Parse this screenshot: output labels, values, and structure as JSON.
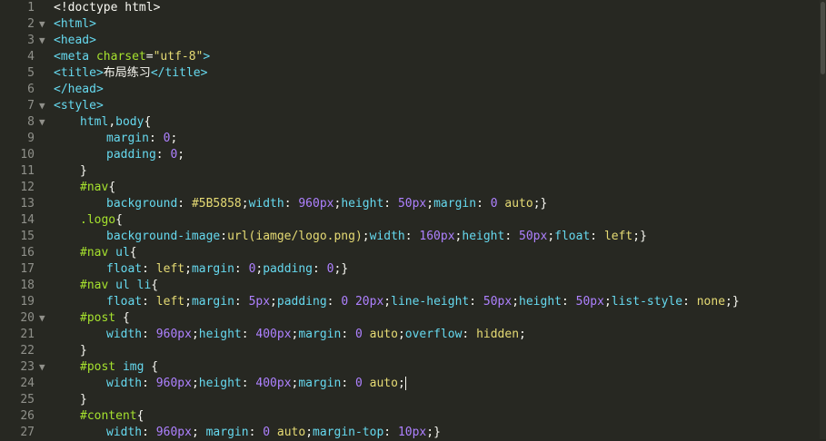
{
  "editor": {
    "colors": {
      "background": "#272822",
      "line_number": "#8f908a",
      "default": "#f8f8f2",
      "tag": "#66d9ef",
      "keyword": "#f92672",
      "attribute": "#a6e22e",
      "string": "#e6db74",
      "number": "#ae81ff"
    },
    "fold_icon": "triangle-down-icon",
    "lines": [
      {
        "num": "1",
        "indent": 0,
        "fold": "",
        "tokens": [
          {
            "t": "<!doctype html>",
            "c": "#f8f8f2"
          }
        ]
      },
      {
        "num": "2",
        "indent": 0,
        "fold": "▼",
        "tokens": [
          {
            "t": "<html>",
            "c": "#66d9ef"
          }
        ]
      },
      {
        "num": "3",
        "indent": 0,
        "fold": "▼",
        "tokens": [
          {
            "t": "<head>",
            "c": "#66d9ef"
          }
        ]
      },
      {
        "num": "4",
        "indent": 0,
        "fold": "",
        "tokens": [
          {
            "t": "<meta ",
            "c": "#66d9ef"
          },
          {
            "t": "charset",
            "c": "#a6e22e"
          },
          {
            "t": "=",
            "c": "#f8f8f2"
          },
          {
            "t": "\"utf-8\"",
            "c": "#e6db74"
          },
          {
            "t": ">",
            "c": "#66d9ef"
          }
        ]
      },
      {
        "num": "5",
        "indent": 0,
        "fold": "",
        "tokens": [
          {
            "t": "<title>",
            "c": "#66d9ef"
          },
          {
            "t": "布局练习",
            "c": "#f8f8f2"
          },
          {
            "t": "</title>",
            "c": "#66d9ef"
          }
        ]
      },
      {
        "num": "6",
        "indent": 0,
        "fold": "",
        "tokens": [
          {
            "t": "</head>",
            "c": "#66d9ef"
          }
        ]
      },
      {
        "num": "7",
        "indent": 0,
        "fold": "▼",
        "tokens": [
          {
            "t": "<style>",
            "c": "#66d9ef"
          }
        ]
      },
      {
        "num": "8",
        "indent": 1,
        "fold": "▼",
        "tokens": [
          {
            "t": "html",
            "c": "#66d9ef"
          },
          {
            "t": ",",
            "c": "#f8f8f2"
          },
          {
            "t": "body",
            "c": "#66d9ef"
          },
          {
            "t": "{",
            "c": "#f8f8f2"
          }
        ]
      },
      {
        "num": "9",
        "indent": 2,
        "fold": "",
        "tokens": [
          {
            "t": "margin",
            "c": "#66d9ef"
          },
          {
            "t": ": ",
            "c": "#f8f8f2"
          },
          {
            "t": "0",
            "c": "#ae81ff"
          },
          {
            "t": ";",
            "c": "#f8f8f2"
          }
        ]
      },
      {
        "num": "10",
        "indent": 2,
        "fold": "",
        "tokens": [
          {
            "t": "padding",
            "c": "#66d9ef"
          },
          {
            "t": ": ",
            "c": "#f8f8f2"
          },
          {
            "t": "0",
            "c": "#ae81ff"
          },
          {
            "t": ";",
            "c": "#f8f8f2"
          }
        ]
      },
      {
        "num": "11",
        "indent": 1,
        "fold": "",
        "tokens": [
          {
            "t": "}",
            "c": "#f8f8f2"
          }
        ]
      },
      {
        "num": "12",
        "indent": 1,
        "fold": "",
        "tokens": [
          {
            "t": "#nav",
            "c": "#a6e22e"
          },
          {
            "t": "{",
            "c": "#f8f8f2"
          }
        ]
      },
      {
        "num": "13",
        "indent": 2,
        "fold": "",
        "tokens": [
          {
            "t": "background",
            "c": "#66d9ef"
          },
          {
            "t": ": ",
            "c": "#f8f8f2"
          },
          {
            "t": "#5B5858",
            "c": "#e6db74"
          },
          {
            "t": ";",
            "c": "#f8f8f2"
          },
          {
            "t": "width",
            "c": "#66d9ef"
          },
          {
            "t": ": ",
            "c": "#f8f8f2"
          },
          {
            "t": "960px",
            "c": "#ae81ff"
          },
          {
            "t": ";",
            "c": "#f8f8f2"
          },
          {
            "t": "height",
            "c": "#66d9ef"
          },
          {
            "t": ": ",
            "c": "#f8f8f2"
          },
          {
            "t": "50px",
            "c": "#ae81ff"
          },
          {
            "t": ";",
            "c": "#f8f8f2"
          },
          {
            "t": "margin",
            "c": "#66d9ef"
          },
          {
            "t": ": ",
            "c": "#f8f8f2"
          },
          {
            "t": "0",
            "c": "#ae81ff"
          },
          {
            "t": " ",
            "c": "#f8f8f2"
          },
          {
            "t": "auto",
            "c": "#e6db74"
          },
          {
            "t": ";}",
            "c": "#f8f8f2"
          }
        ]
      },
      {
        "num": "14",
        "indent": 1,
        "fold": "",
        "tokens": [
          {
            "t": ".logo",
            "c": "#a6e22e"
          },
          {
            "t": "{",
            "c": "#f8f8f2"
          }
        ]
      },
      {
        "num": "15",
        "indent": 2,
        "fold": "",
        "tokens": [
          {
            "t": "background-image",
            "c": "#66d9ef"
          },
          {
            "t": ":",
            "c": "#f8f8f2"
          },
          {
            "t": "url",
            "c": "#e6db74"
          },
          {
            "t": "(iamge/logo.png)",
            "c": "#e6db74"
          },
          {
            "t": ";",
            "c": "#f8f8f2"
          },
          {
            "t": "width",
            "c": "#66d9ef"
          },
          {
            "t": ": ",
            "c": "#f8f8f2"
          },
          {
            "t": "160px",
            "c": "#ae81ff"
          },
          {
            "t": ";",
            "c": "#f8f8f2"
          },
          {
            "t": "height",
            "c": "#66d9ef"
          },
          {
            "t": ": ",
            "c": "#f8f8f2"
          },
          {
            "t": "50px",
            "c": "#ae81ff"
          },
          {
            "t": ";",
            "c": "#f8f8f2"
          },
          {
            "t": "float",
            "c": "#66d9ef"
          },
          {
            "t": ": ",
            "c": "#f8f8f2"
          },
          {
            "t": "left",
            "c": "#e6db74"
          },
          {
            "t": ";}",
            "c": "#f8f8f2"
          }
        ]
      },
      {
        "num": "16",
        "indent": 1,
        "fold": "",
        "tokens": [
          {
            "t": "#nav ",
            "c": "#a6e22e"
          },
          {
            "t": "ul",
            "c": "#66d9ef"
          },
          {
            "t": "{",
            "c": "#f8f8f2"
          }
        ]
      },
      {
        "num": "17",
        "indent": 2,
        "fold": "",
        "tokens": [
          {
            "t": "float",
            "c": "#66d9ef"
          },
          {
            "t": ": ",
            "c": "#f8f8f2"
          },
          {
            "t": "left",
            "c": "#e6db74"
          },
          {
            "t": ";",
            "c": "#f8f8f2"
          },
          {
            "t": "margin",
            "c": "#66d9ef"
          },
          {
            "t": ": ",
            "c": "#f8f8f2"
          },
          {
            "t": "0",
            "c": "#ae81ff"
          },
          {
            "t": ";",
            "c": "#f8f8f2"
          },
          {
            "t": "padding",
            "c": "#66d9ef"
          },
          {
            "t": ": ",
            "c": "#f8f8f2"
          },
          {
            "t": "0",
            "c": "#ae81ff"
          },
          {
            "t": ";}",
            "c": "#f8f8f2"
          }
        ]
      },
      {
        "num": "18",
        "indent": 1,
        "fold": "",
        "tokens": [
          {
            "t": "#nav ",
            "c": "#a6e22e"
          },
          {
            "t": "ul li",
            "c": "#66d9ef"
          },
          {
            "t": "{",
            "c": "#f8f8f2"
          }
        ]
      },
      {
        "num": "19",
        "indent": 2,
        "fold": "",
        "tokens": [
          {
            "t": "float",
            "c": "#66d9ef"
          },
          {
            "t": ": ",
            "c": "#f8f8f2"
          },
          {
            "t": "left",
            "c": "#e6db74"
          },
          {
            "t": ";",
            "c": "#f8f8f2"
          },
          {
            "t": "margin",
            "c": "#66d9ef"
          },
          {
            "t": ": ",
            "c": "#f8f8f2"
          },
          {
            "t": "5px",
            "c": "#ae81ff"
          },
          {
            "t": ";",
            "c": "#f8f8f2"
          },
          {
            "t": "padding",
            "c": "#66d9ef"
          },
          {
            "t": ": ",
            "c": "#f8f8f2"
          },
          {
            "t": "0 20px",
            "c": "#ae81ff"
          },
          {
            "t": ";",
            "c": "#f8f8f2"
          },
          {
            "t": "line-height",
            "c": "#66d9ef"
          },
          {
            "t": ": ",
            "c": "#f8f8f2"
          },
          {
            "t": "50px",
            "c": "#ae81ff"
          },
          {
            "t": ";",
            "c": "#f8f8f2"
          },
          {
            "t": "height",
            "c": "#66d9ef"
          },
          {
            "t": ": ",
            "c": "#f8f8f2"
          },
          {
            "t": "50px",
            "c": "#ae81ff"
          },
          {
            "t": ";",
            "c": "#f8f8f2"
          },
          {
            "t": "list-style",
            "c": "#66d9ef"
          },
          {
            "t": ": ",
            "c": "#f8f8f2"
          },
          {
            "t": "none",
            "c": "#e6db74"
          },
          {
            "t": ";}",
            "c": "#f8f8f2"
          }
        ]
      },
      {
        "num": "20",
        "indent": 1,
        "fold": "▼",
        "tokens": [
          {
            "t": "#post ",
            "c": "#a6e22e"
          },
          {
            "t": "{",
            "c": "#f8f8f2"
          }
        ]
      },
      {
        "num": "21",
        "indent": 2,
        "fold": "",
        "tokens": [
          {
            "t": "width",
            "c": "#66d9ef"
          },
          {
            "t": ": ",
            "c": "#f8f8f2"
          },
          {
            "t": "960px",
            "c": "#ae81ff"
          },
          {
            "t": ";",
            "c": "#f8f8f2"
          },
          {
            "t": "height",
            "c": "#66d9ef"
          },
          {
            "t": ": ",
            "c": "#f8f8f2"
          },
          {
            "t": "400px",
            "c": "#ae81ff"
          },
          {
            "t": ";",
            "c": "#f8f8f2"
          },
          {
            "t": "margin",
            "c": "#66d9ef"
          },
          {
            "t": ": ",
            "c": "#f8f8f2"
          },
          {
            "t": "0",
            "c": "#ae81ff"
          },
          {
            "t": " ",
            "c": "#f8f8f2"
          },
          {
            "t": "auto",
            "c": "#e6db74"
          },
          {
            "t": ";",
            "c": "#f8f8f2"
          },
          {
            "t": "overflow",
            "c": "#66d9ef"
          },
          {
            "t": ": ",
            "c": "#f8f8f2"
          },
          {
            "t": "hidden",
            "c": "#e6db74"
          },
          {
            "t": ";",
            "c": "#f8f8f2"
          }
        ]
      },
      {
        "num": "22",
        "indent": 1,
        "fold": "",
        "tokens": [
          {
            "t": "}",
            "c": "#f8f8f2"
          }
        ]
      },
      {
        "num": "23",
        "indent": 1,
        "fold": "▼",
        "tokens": [
          {
            "t": "#post ",
            "c": "#a6e22e"
          },
          {
            "t": "img",
            "c": "#66d9ef"
          },
          {
            "t": " {",
            "c": "#f8f8f2"
          }
        ]
      },
      {
        "num": "24",
        "indent": 2,
        "fold": "",
        "cursor": true,
        "tokens": [
          {
            "t": "width",
            "c": "#66d9ef"
          },
          {
            "t": ": ",
            "c": "#f8f8f2"
          },
          {
            "t": "960px",
            "c": "#ae81ff"
          },
          {
            "t": ";",
            "c": "#f8f8f2"
          },
          {
            "t": "height",
            "c": "#66d9ef"
          },
          {
            "t": ": ",
            "c": "#f8f8f2"
          },
          {
            "t": "400px",
            "c": "#ae81ff"
          },
          {
            "t": ";",
            "c": "#f8f8f2"
          },
          {
            "t": "margin",
            "c": "#66d9ef"
          },
          {
            "t": ": ",
            "c": "#f8f8f2"
          },
          {
            "t": "0",
            "c": "#ae81ff"
          },
          {
            "t": " ",
            "c": "#f8f8f2"
          },
          {
            "t": "auto",
            "c": "#e6db74"
          },
          {
            "t": ";",
            "c": "#f8f8f2"
          }
        ]
      },
      {
        "num": "25",
        "indent": 1,
        "fold": "",
        "tokens": [
          {
            "t": "}",
            "c": "#f8f8f2"
          }
        ]
      },
      {
        "num": "26",
        "indent": 1,
        "fold": "",
        "tokens": [
          {
            "t": "#content",
            "c": "#a6e22e"
          },
          {
            "t": "{",
            "c": "#f8f8f2"
          }
        ]
      },
      {
        "num": "27",
        "indent": 2,
        "fold": "",
        "tokens": [
          {
            "t": "width",
            "c": "#66d9ef"
          },
          {
            "t": ": ",
            "c": "#f8f8f2"
          },
          {
            "t": "960px",
            "c": "#ae81ff"
          },
          {
            "t": "; ",
            "c": "#f8f8f2"
          },
          {
            "t": "margin",
            "c": "#66d9ef"
          },
          {
            "t": ": ",
            "c": "#f8f8f2"
          },
          {
            "t": "0",
            "c": "#ae81ff"
          },
          {
            "t": " ",
            "c": "#f8f8f2"
          },
          {
            "t": "auto",
            "c": "#e6db74"
          },
          {
            "t": ";",
            "c": "#f8f8f2"
          },
          {
            "t": "margin-top",
            "c": "#66d9ef"
          },
          {
            "t": ": ",
            "c": "#f8f8f2"
          },
          {
            "t": "10px",
            "c": "#ae81ff"
          },
          {
            "t": ";}",
            "c": "#f8f8f2"
          }
        ]
      }
    ]
  }
}
